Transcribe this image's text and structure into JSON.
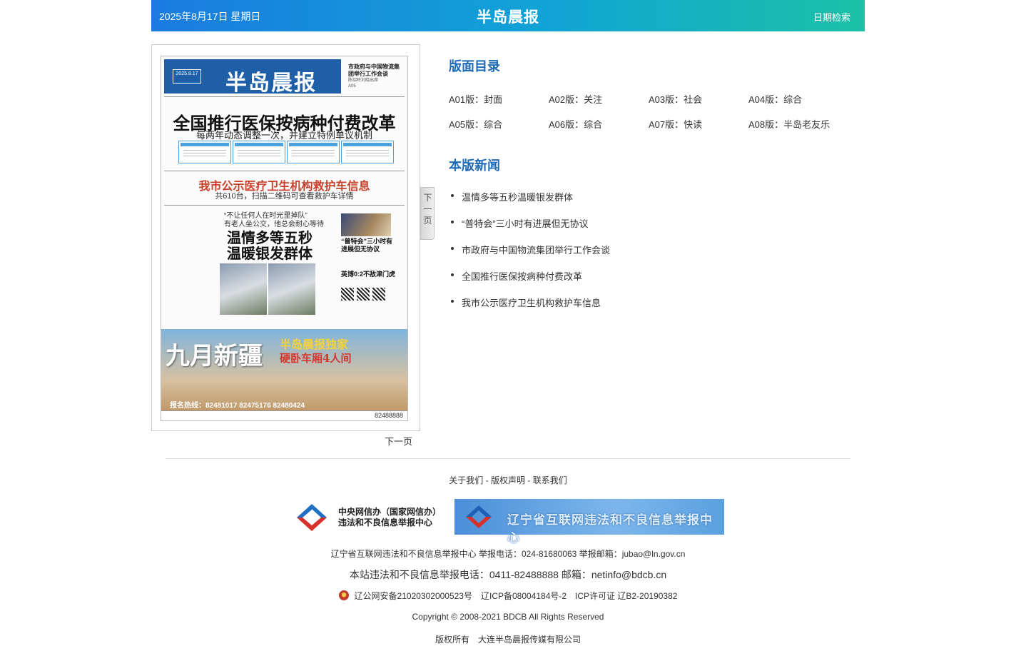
{
  "header": {
    "date": "2025年8月17日 星期日",
    "logo": "半岛晨报",
    "search_label": "日期检索"
  },
  "paper": {
    "date_badge": "2025.8.17",
    "masthead": "半岛晨报",
    "side_title": "市政府与中国物流集团举行工作会谈",
    "side_small": "陈绍旺刘晓出席",
    "side_page": "A05",
    "headline": "全国推行医保按病种付费改革",
    "subheadline": "每两年动态调整一次，并建立特例单议机制",
    "red_headline": "我市公示医疗卫生机构救护车信息",
    "red_sub": "共610台，扫描二维码可查看救护车详情",
    "quote": "“不让任何人在时光里掉队”",
    "quote2": "有老人坐公交，他总会耐心等待",
    "big1": "温情多等五秒",
    "big2": "温暖银发群体",
    "right_text": "“普特会”三小时有进展但无协议",
    "right_text2": "英博0:2不敌津门虎",
    "ad_title": "九月新疆",
    "ad_sub1": "半岛晨报独家",
    "ad_sub2": "硬卧车厢4人间",
    "ad_hotline": "报名热线：82481017  82475176  82480424",
    "foot_number": "82488888"
  },
  "next_tab_label": "下一页",
  "next_page_label": "下一页",
  "toc": {
    "title": "版面目录",
    "items": [
      "A01版：封面",
      "A02版：关注",
      "A03版：社会",
      "A04版：综合",
      "A05版：综合",
      "A06版：综合",
      "A07版：快读",
      "A08版：半岛老友乐"
    ]
  },
  "news": {
    "title": "本版新闻",
    "items": [
      "温情多等五秒温暖银发群体",
      "“普特会”三小时有进展但无协议",
      "市政府与中国物流集团举行工作会谈",
      "全国推行医保按病种付费改革",
      "我市公示医疗卫生机构救护车信息"
    ]
  },
  "footer": {
    "links": [
      "关于我们",
      "版权声明",
      "联系我们"
    ],
    "banner1_line1": "中央网信办（国家网信办）",
    "banner1_line2": "违法和不良信息举报中心",
    "banner2": "辽宁省互联网违法和不良信息举报中心",
    "line1": "辽宁省互联网违法和不良信息举报中心 举报电话：024-81680063 举报邮箱：jubao@ln.gov.cn",
    "line2": "本站违法和不良信息举报电话：0411-82488888 邮箱：netinfo@bdcb.cn",
    "line3": "辽公网安备21020302000523号　辽ICP备08004184号-2　ICP许可证 辽B2-20190382",
    "line4": "Copyright © 2008-2021 BDCB All Rights Reserved",
    "line5": "版权所有　大连半岛晨报传媒有限公司"
  },
  "colors": {
    "header_start": "#1a7be0",
    "header_end": "#1cc1a6",
    "section_title": "#1d6bb8"
  }
}
